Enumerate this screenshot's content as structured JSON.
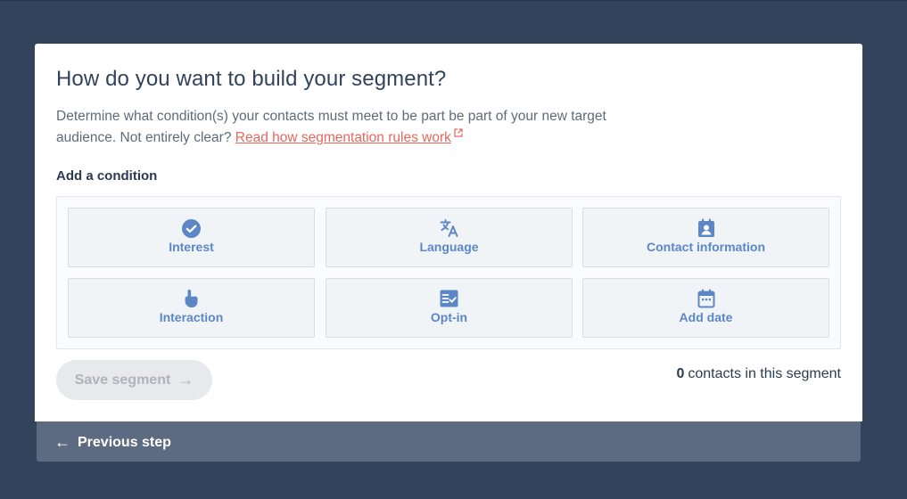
{
  "modal": {
    "title": "How do you want to build your segment?",
    "description_prefix": "Determine what condition(s) your contacts must meet to be part be part of your new target audience. Not entirely clear?",
    "help_link": "Read how segmentation rules work",
    "section_label": "Add a condition"
  },
  "conditions": [
    {
      "label": "Interest",
      "icon": "check-circle-icon"
    },
    {
      "label": "Language",
      "icon": "translate-icon"
    },
    {
      "label": "Contact information",
      "icon": "contact-card-icon"
    },
    {
      "label": "Interaction",
      "icon": "touch-hand-icon"
    },
    {
      "label": "Opt-in",
      "icon": "checklist-icon"
    },
    {
      "label": "Add date",
      "icon": "calendar-icon"
    }
  ],
  "footer_actions": {
    "save_label": "Save segment",
    "save_arrow": "→",
    "contact_count": "0",
    "contact_count_suffix": "contacts in this segment",
    "previous_label": "Previous step",
    "previous_arrow": "←"
  },
  "colors": {
    "background": "#33435c",
    "accent_blue": "#5b87c7",
    "link": "#e8675a",
    "footer": "#5d6b82"
  }
}
